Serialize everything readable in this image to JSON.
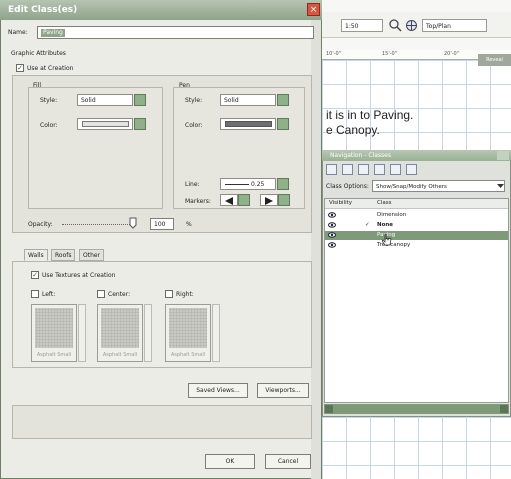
{
  "app": {
    "toolbar": {
      "zoom_value": "1:50",
      "view_value": "Top/Plan"
    },
    "ruler_ticks": [
      "10'-0\"",
      "15'-0\"",
      "20'-0\""
    ],
    "reveal_button": "Reveal",
    "canvas_text": [
      "it is in to Paving.",
      "e Canopy."
    ]
  },
  "palette": {
    "title": "Navigation - Classes",
    "class_options_label": "Class Options:",
    "class_options_value": "Show/Snap/Modify Others",
    "columns": {
      "visibility": "Visibility",
      "class": "Class"
    },
    "rows": [
      {
        "check": "",
        "name": "Dimension",
        "bold": false,
        "selected": false
      },
      {
        "check": "✓",
        "name": "None",
        "bold": true,
        "selected": false
      },
      {
        "check": "",
        "name": "Paving",
        "bold": false,
        "selected": true
      },
      {
        "check": "",
        "name": "Tree canopy",
        "bold": false,
        "selected": false
      }
    ]
  },
  "dialog": {
    "title": "Edit Class(es)",
    "name_label": "Name:",
    "name_value": "Paving",
    "graphic_attributes_label": "Graphic Attributes",
    "use_at_creation_label": "Use at Creation",
    "use_at_creation_checked": true,
    "fill": {
      "group_label": "Fill",
      "style_label": "Style:",
      "style_value": "Solid",
      "color_label": "Color:",
      "color": "#e4e4de"
    },
    "pen": {
      "group_label": "Pen",
      "style_label": "Style:",
      "style_value": "Solid",
      "color_label": "Color:",
      "color": "#6e6e6e",
      "line_label": "Line:",
      "line_value": "0.25",
      "markers_label": "Markers:"
    },
    "opacity_label": "Opacity:",
    "opacity_value": "100",
    "opacity_unit": "%",
    "tabs": [
      "Walls",
      "Roofs",
      "Other"
    ],
    "active_tab": "Walls",
    "use_textures_label": "Use Textures at Creation",
    "use_textures_checked": true,
    "texture_slots": [
      {
        "label": "Left:",
        "caption": "Asphalt Small"
      },
      {
        "label": "Center:",
        "caption": "Asphalt Small"
      },
      {
        "label": "Right:",
        "caption": "Asphalt Small"
      }
    ],
    "saved_views_button": "Saved Views...",
    "viewports_button": "Viewports...",
    "ok_button": "OK",
    "cancel_button": "Cancel"
  }
}
